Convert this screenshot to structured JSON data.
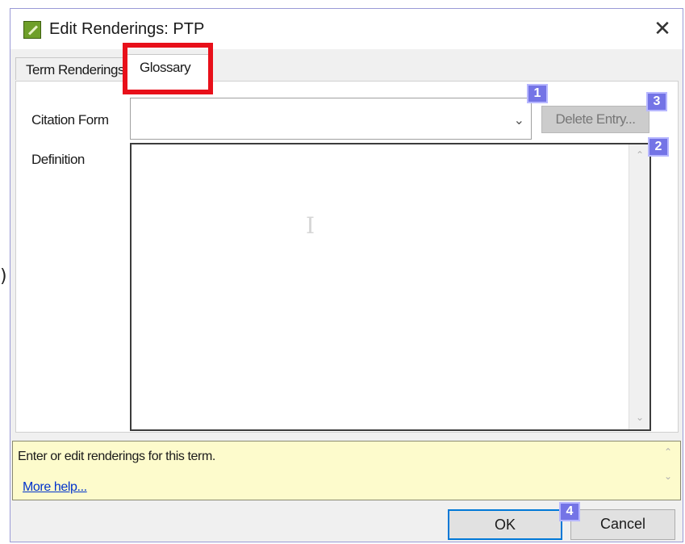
{
  "window": {
    "title": "Edit Renderings: PTP",
    "close_symbol": "✕"
  },
  "tabs": [
    {
      "label": "Term Renderings",
      "active": false
    },
    {
      "label": "Glossary",
      "active": true
    }
  ],
  "glossary": {
    "citation_form_label": "Citation Form",
    "citation_form_value": "",
    "definition_label": "Definition",
    "definition_value": "",
    "delete_entry_label": "Delete Entry...",
    "delete_entry_enabled": false
  },
  "badges": [
    "1",
    "2",
    "3",
    "4"
  ],
  "help": {
    "text": "Enter or edit renderings for this term.",
    "link": "More help..."
  },
  "buttons": {
    "ok": "OK",
    "cancel": "Cancel"
  },
  "colors": {
    "highlight": "#e8101a",
    "badge": "#7474e6",
    "help_background": "#fdfbcc",
    "focus_border": "#0078d7",
    "link": "#0033cc"
  },
  "icons": {
    "app": "app-leaf-icon",
    "close": "close-icon",
    "dropdown": "chevron-down-icon",
    "text_cursor": "i-beam-cursor-icon"
  }
}
